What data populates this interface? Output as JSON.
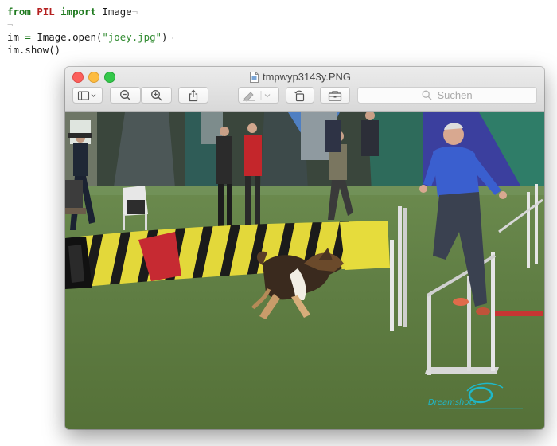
{
  "editor": {
    "line1": {
      "kw_from": "from",
      "module": "PIL",
      "kw_import": "import",
      "name": "Image"
    },
    "line3": {
      "var": "im",
      "op": "=",
      "call": "Image.open(",
      "arg": "\"joey.jpg\"",
      "close": ")"
    },
    "line4": {
      "text": "im.show()"
    },
    "whitespace_marker": "¬"
  },
  "window": {
    "title": "tmpwyp3143y.PNG",
    "search_placeholder": "Suchen",
    "controls": [
      "close",
      "minimize",
      "maximize"
    ],
    "toolbar": [
      "sidebar-icon",
      "zoom-out-icon",
      "zoom-in-icon",
      "share-icon",
      "markup-pen-icon",
      "rotate-icon",
      "toolbox-icon"
    ]
  },
  "photo": {
    "subject": "Sheltie dog running through agility course",
    "watermark_text": "Dreamshots"
  },
  "colors": {
    "keyword": "#1f7a1f",
    "module": "#b52020",
    "string": "#2f8a2f",
    "close": "#fc605c",
    "minimize": "#fdbc40",
    "maximize": "#34c84a"
  }
}
